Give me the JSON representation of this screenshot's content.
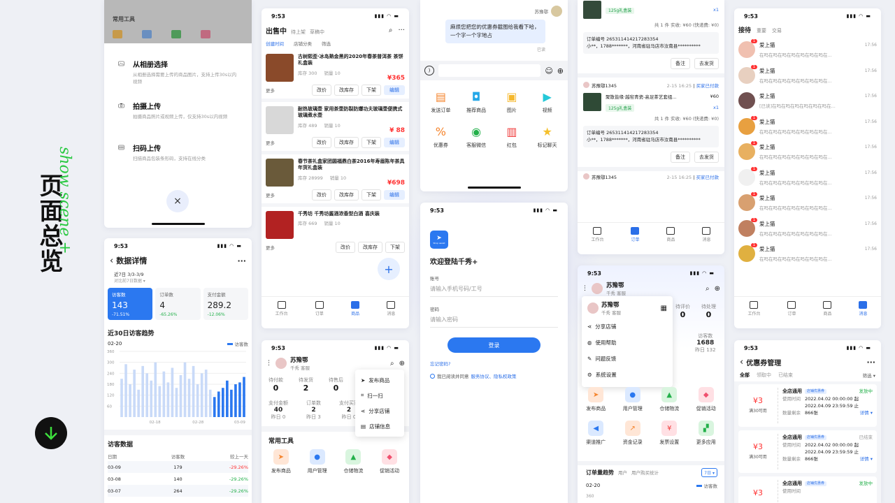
{
  "deco": {
    "title": "页面总览",
    "script_text": "show scene +"
  },
  "p1": {
    "tools_title": "常用工具",
    "options": [
      {
        "title": "从相册选择",
        "desc": "从相册选择需要上传的商品图片，支持上传30s以内视频"
      },
      {
        "title": "拍摄上传",
        "desc": "拍摄商品照片或视频上传，仅支持30s以内视频"
      },
      {
        "title": "扫码上传",
        "desc": "扫描商品包装条形码，支持在线分类"
      }
    ],
    "close": "×"
  },
  "p2": {
    "time": "9:53",
    "title": "数据详情",
    "range": "近7日 3/3-3/9",
    "compare": "对比前7日数据 ▾",
    "metrics": [
      {
        "label": "访客数",
        "value": "143",
        "delta": "-71.51%"
      },
      {
        "label": "订单数",
        "value": "4",
        "delta": "-65.26%"
      },
      {
        "label": "支付金额",
        "value": "289.2",
        "delta": "-12.06%"
      }
    ],
    "trend_title": "近30日访客趋势",
    "trend_date": "02-20",
    "legend": "访客数",
    "yticks": [
      "360",
      "300",
      "240",
      "180",
      "120",
      "60"
    ],
    "xticks": [
      "02-18",
      "02-28",
      "03-09"
    ],
    "visitor_title": "访客数据",
    "visitor_headers": [
      "日期",
      "访客数",
      "较上一天"
    ],
    "visitor_rows": [
      {
        "date": "03-09",
        "value": "179",
        "delta": "-29.26%"
      },
      {
        "date": "03-08",
        "value": "140",
        "delta": "-29.26%"
      },
      {
        "date": "03-07",
        "value": "264",
        "delta": "-29.26%"
      }
    ]
  },
  "chart_data": {
    "type": "bar",
    "title": "近30日访客趋势",
    "legend": [
      "访客数"
    ],
    "ylim": [
      0,
      360
    ],
    "values": [
      210,
      290,
      180,
      260,
      150,
      280,
      240,
      200,
      300,
      170,
      250,
      190,
      270,
      160,
      230,
      300,
      210,
      280,
      180,
      240,
      260,
      150,
      110,
      140,
      160,
      200,
      150,
      180,
      190,
      220
    ],
    "xticks": [
      "02-18",
      "02-28",
      "03-09"
    ]
  },
  "p3": {
    "time": "9:53",
    "tabs": [
      "出售中",
      "待上架",
      "草稿中"
    ],
    "filters": [
      "创建时间",
      "店铺分类",
      "筛选"
    ],
    "products": [
      {
        "name": "古树熙歪·冰岛熟金黑的2020年春茶普洱茶 茶饼 礼盒装",
        "stock": "库存 300",
        "sales": "销量 10",
        "price": "¥365"
      },
      {
        "name": "耐热玻璃壶 家用茶壶防裂防爆功夫玻璃壶便携式 玻璃煮水壶",
        "stock": "库存 489",
        "sales": "销量 10",
        "price": "¥ 88"
      },
      {
        "name": "春节茶礼盒家团圆福鼎白茶2016年寿眉陈年茶具年货礼盒装",
        "stock": "库存 28999",
        "sales": "销量 10",
        "price": "¥698"
      },
      {
        "name": "千秀坊 千秀坊酱酒浓香型白酒 喜庆装",
        "stock": "库存 669",
        "sales": "销量 10",
        "price": ""
      }
    ],
    "actions": [
      "更多",
      "改价",
      "改库存",
      "下架",
      "编辑"
    ],
    "nav": [
      "工作台",
      "订单",
      "商品",
      "消息"
    ]
  },
  "p4": {
    "time": "9:53",
    "shop": "苏豫鄂",
    "role": "千秀 客服",
    "stats_labels": [
      "待付款",
      "待发货",
      "待售后",
      "待评价"
    ],
    "stats_values": [
      "0",
      "2",
      "0",
      ""
    ],
    "stats2_labels": [
      "支付金额",
      "订单数",
      "支付买家"
    ],
    "stats2_values": [
      "40",
      "2",
      "2"
    ],
    "stats2_sub": [
      "昨日 0",
      "昨日 3",
      "昨日 0"
    ],
    "menu": [
      "发布商品",
      "扫一扫",
      "分享店铺",
      "店铺信息"
    ],
    "tools_title": "常用工具",
    "tools": [
      "发布商品",
      "用户管理",
      "仓储物流",
      "促销活动"
    ]
  },
  "p5": {
    "sender": "苏豫鄂",
    "message": "麻烦您把您的优惠券截图给我看下哈，一个字一个字地占",
    "read": "已读",
    "apps": [
      "发送订单",
      "推荐商品",
      "图片",
      "视频",
      "优惠券",
      "客服微信",
      "红包",
      "标记聊天"
    ]
  },
  "p6": {
    "time": "9:53",
    "logo_sub": "Shop assist",
    "welcome": "欢迎登陆千秀+",
    "account_label": "账号",
    "account_placeholder": "请输入手机号码/工号",
    "password_label": "密码",
    "password_placeholder": "请输入密码",
    "login": "登录",
    "forgot": "忘记密码?",
    "agree": "我已阅读并同意",
    "agree_links": "服务协议、隐私权政策"
  },
  "p7": {
    "orders": [
      {
        "user": "",
        "time": "",
        "status": "",
        "product": "",
        "spec": "125g礼盒装",
        "qty": "x1",
        "summary": "共 1 件 实收: ¥60 (快递费: ¥0)",
        "order_no": "订单编号 265311414217283354",
        "address": "小**，1788*******，河南省驻马店市汝南县**********"
      },
      {
        "user": "苏豫鄂1345",
        "time": "2-15 16:25",
        "status": "买家已付款",
        "product": "聚散皆缘·越窑青瓷-高足茶艺套组...",
        "price": "¥60",
        "spec": "125g礼盒装",
        "qty": "x1",
        "summary": "共 1 件 实收: ¥60 (快递费: ¥0)",
        "order_no": "订单编号 265311414217283354",
        "address": "小**，1788*******，河南省驻马店市汝南县**********"
      },
      {
        "user": "苏豫鄂1345",
        "time": "2-15 16:25",
        "status": "买家已付款"
      }
    ],
    "btns": [
      "备注",
      "去发货"
    ],
    "nav": [
      "工作台",
      "订单",
      "商品",
      "消息"
    ]
  },
  "p8": {
    "time": "9:53",
    "shop": "苏豫鄂",
    "role": "千秀 客服",
    "popup": [
      "分享店铺",
      "使用帮助",
      "问题反馈",
      "系统设置"
    ],
    "stats_labels": [
      "待评价",
      "待处理"
    ],
    "stats_values": [
      "0",
      "0"
    ],
    "visits_label": "访客数",
    "visits_value": "1688",
    "visits_sub": "昨日 132",
    "tools": [
      "发布商品",
      "用户管理",
      "仓储物流",
      "促销活动",
      "渠道推广",
      "资金记录",
      "发票设置",
      "更多应用"
    ],
    "trend_tabs": [
      "订单量趋势",
      "用户",
      "用户购买统计"
    ],
    "trend_range": "7日 ▾",
    "trend_date": "02-20",
    "legend": "访客数",
    "ytick": "360"
  },
  "p9": {
    "time": "9:53",
    "tabs": [
      "接待",
      "重要",
      "交易"
    ],
    "chats": [
      {
        "name": "爱上猫",
        "msg": "在吗在吗在吗在吗在吗在吗在吗在...",
        "time": "17:56",
        "badge": "1"
      },
      {
        "name": "爱上猫",
        "msg": "在吗在吗在吗在吗在吗在吗在吗在...",
        "time": "17:56",
        "badge": "1"
      },
      {
        "name": "爱上猫",
        "msg": "[已读]在吗在吗在吗在吗在吗在吗在...",
        "time": "17:56",
        "badge": ""
      },
      {
        "name": "爱上猫",
        "msg": "在吗在吗在吗在吗在吗在吗在吗在...",
        "time": "17:56",
        "badge": "1"
      },
      {
        "name": "爱上猫",
        "msg": "在吗在吗在吗在吗在吗在吗在吗在...",
        "time": "17:56",
        "badge": "1"
      },
      {
        "name": "爱上猫",
        "msg": "在吗在吗在吗在吗在吗在吗在吗在...",
        "time": "17:56",
        "badge": "1"
      },
      {
        "name": "爱上猫",
        "msg": "在吗在吗在吗在吗在吗在吗在吗在...",
        "time": "17:56",
        "badge": "1"
      },
      {
        "name": "爱上猫",
        "msg": "在吗在吗在吗在吗在吗在吗在吗在...",
        "time": "17:56",
        "badge": "1"
      },
      {
        "name": "爱上猫",
        "msg": "在吗在吗在吗在吗在吗在吗在吗在...",
        "time": "17:56",
        "badge": "1"
      }
    ],
    "nav": [
      "工作台",
      "订单",
      "商品",
      "消息"
    ]
  },
  "p10": {
    "time": "9:53",
    "title": "优惠券管理",
    "tabs": [
      "全部",
      "领取中",
      "已结束"
    ],
    "filter": "筛选 ▾",
    "coupons": [
      {
        "amount": "¥3",
        "cond": "满30可用",
        "name": "全店通用",
        "tag": "店铺优惠券",
        "status": "发放中",
        "time_label": "使用时间",
        "time": "2022.04.02 00:00:00 起",
        "time2": "2022.04.09 23:59:59 止",
        "remain_label": "数量剩余",
        "remain": "866张",
        "detail": "详情 ▾"
      },
      {
        "amount": "¥3",
        "cond": "满30可用",
        "name": "全店通用",
        "tag": "店铺优惠券",
        "status": "已结束",
        "time_label": "使用时间",
        "time": "2022.04.02 00:00:00 起",
        "time2": "2022.04.09 23:59:59 止",
        "remain_label": "数量剩余",
        "remain": "866张",
        "detail": "详情 ▾"
      },
      {
        "amount": "¥3",
        "cond": "",
        "name": "全店通用",
        "tag": "店铺优惠券",
        "status": "发放中",
        "time_label": "使用时间",
        "time": "",
        "time2": "",
        "remain_label": "",
        "remain": "",
        "detail": ""
      }
    ]
  }
}
